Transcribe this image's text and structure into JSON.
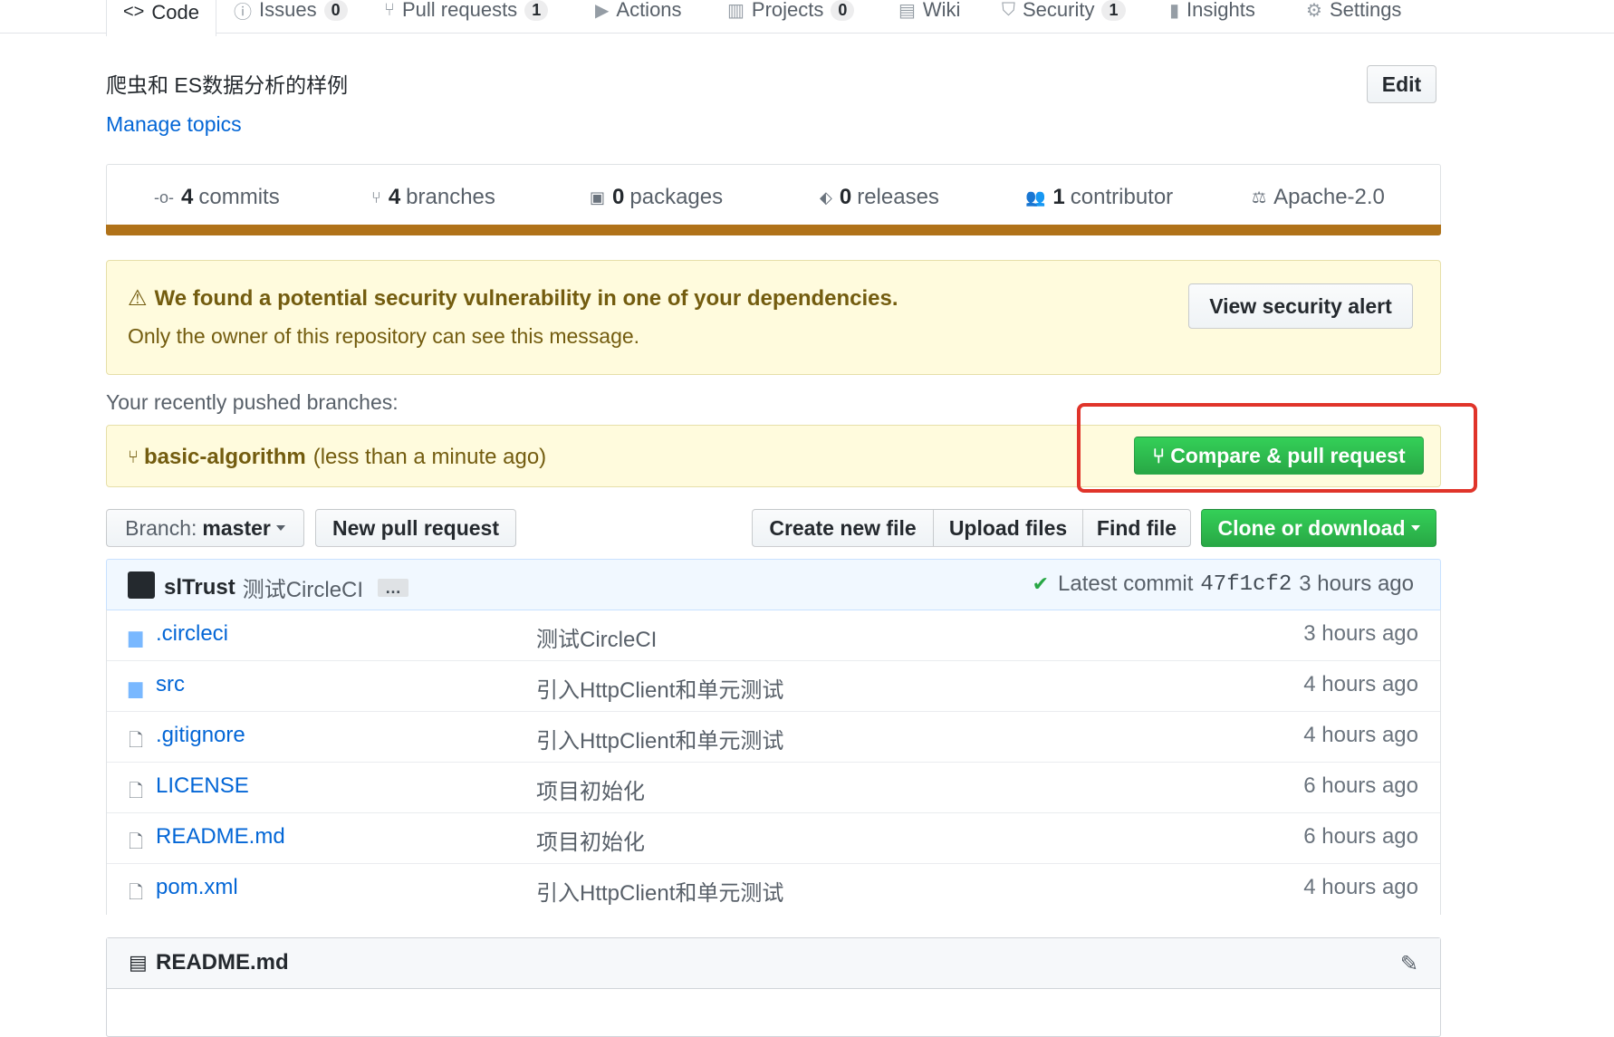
{
  "nav": {
    "tabs": [
      {
        "label": "Code",
        "icon": "code-icon",
        "selected": true
      },
      {
        "label": "Issues",
        "icon": "issue-icon",
        "count": "0"
      },
      {
        "label": "Pull requests",
        "icon": "pull-request-icon",
        "count": "1"
      },
      {
        "label": "Actions",
        "icon": "play-icon"
      },
      {
        "label": "Projects",
        "icon": "project-icon",
        "count": "0"
      },
      {
        "label": "Wiki",
        "icon": "book-icon"
      },
      {
        "label": "Security",
        "icon": "shield-icon",
        "count": "1"
      },
      {
        "label": "Insights",
        "icon": "graph-icon"
      },
      {
        "label": "Settings",
        "icon": "gear-icon"
      }
    ]
  },
  "repo": {
    "description": "爬虫和 ES数据分析的样例",
    "manage_topics": "Manage topics",
    "edit_label": "Edit"
  },
  "numbers": {
    "commits_count": "4",
    "commits_label": "commits",
    "branches_count": "4",
    "branches_label": "branches",
    "packages_count": "0",
    "packages_label": "packages",
    "releases_count": "0",
    "releases_label": "releases",
    "contributors_count": "1",
    "contributors_label": "contributor",
    "license": "Apache-2.0",
    "language_color": "#b07219"
  },
  "alert": {
    "title": "We found a potential security vulnerability in one of your dependencies.",
    "subtitle": "Only the owner of this repository can see this message.",
    "button": "View security alert"
  },
  "recent": {
    "heading": "Your recently pushed branches:",
    "branch": "basic-algorithm",
    "time": "(less than a minute ago)",
    "compare_button": "Compare & pull request"
  },
  "toolbar": {
    "branch_prefix": "Branch:",
    "branch_name": "master",
    "new_pr": "New pull request",
    "create_file": "Create new file",
    "upload_files": "Upload files",
    "find_file": "Find file",
    "clone": "Clone or download"
  },
  "latest_commit": {
    "author": "slTrust",
    "message": "测试CircleCI",
    "ellipsis": "…",
    "label": "Latest commit",
    "sha": "47f1cf2",
    "time": "3 hours ago"
  },
  "files": [
    {
      "name": ".circleci",
      "type": "dir",
      "message": "测试CircleCI",
      "age": "3 hours ago"
    },
    {
      "name": "src",
      "type": "dir",
      "message": "引入HttpClient和单元测试",
      "age": "4 hours ago"
    },
    {
      "name": ".gitignore",
      "type": "file",
      "message": "引入HttpClient和单元测试",
      "age": "4 hours ago"
    },
    {
      "name": "LICENSE",
      "type": "file",
      "message": "项目初始化",
      "age": "6 hours ago"
    },
    {
      "name": "README.md",
      "type": "file",
      "message": "项目初始化",
      "age": "6 hours ago"
    },
    {
      "name": "pom.xml",
      "type": "file",
      "message": "引入HttpClient和单元测试",
      "age": "4 hours ago"
    }
  ],
  "readme": {
    "title": "README.md"
  }
}
